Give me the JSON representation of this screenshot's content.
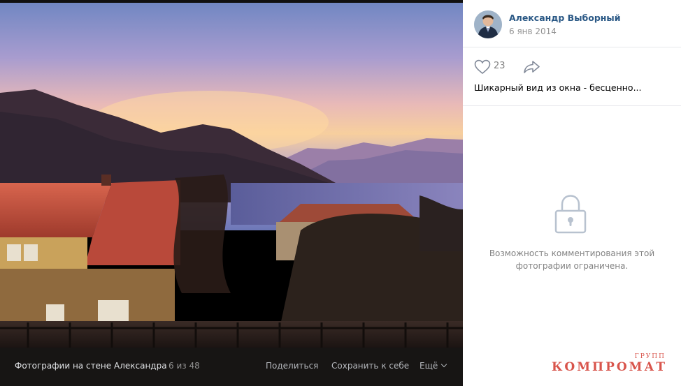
{
  "photo": {
    "description_colors": {
      "sky_top": "#6c86c4",
      "sunset": "#f6c59a",
      "mountain": "#3b2a36",
      "roof": "#c8523f"
    }
  },
  "bottom_bar": {
    "album_title": "Фотографии на стене Александра",
    "counter": "6 из 48",
    "share_label": "Поделиться",
    "save_label": "Сохранить к себе",
    "more_label": "Ещё"
  },
  "author": {
    "name": "Александр Выборный",
    "date": "6 янв 2014"
  },
  "likes": {
    "count": "23"
  },
  "caption": "Шикарный вид из окна - бесценно...",
  "comments": {
    "restricted_text_line1": "Возможность комментирования этой",
    "restricted_text_line2": "фотографии ограничена."
  },
  "watermark": {
    "top": "ГРУПП",
    "main": "КОМПРОМАТ"
  },
  "colors": {
    "link": "#2a5885",
    "muted": "#828282",
    "icon": "#b8c2cf",
    "accent_watermark": "#d8544b"
  }
}
